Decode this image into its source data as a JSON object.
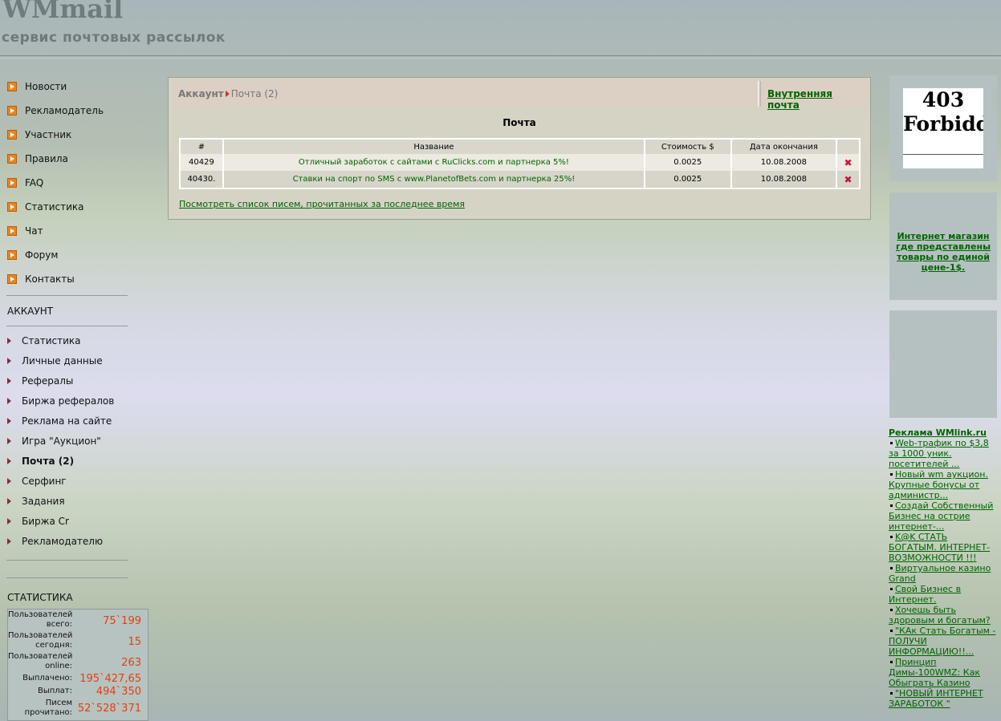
{
  "header": {
    "logo": "WMmail",
    "tagline": "сервис почтовых рассылок"
  },
  "nav": {
    "items": [
      "Новости",
      "Рекламодатель",
      "Участник",
      "Правила",
      "FAQ",
      "Статистика",
      "Чат",
      "Форум",
      "Контакты"
    ]
  },
  "account": {
    "title": "АККАУНТ",
    "items": [
      "Статистика",
      "Личные данные",
      "Рефералы",
      "Биржа рефералов",
      "Реклама на сайте",
      "Игра \"Аукцион\"",
      "Почта (2)",
      "Серфинг",
      "Задания",
      "Биржа Cr",
      "Рекламодателю"
    ],
    "active_index": 6
  },
  "stats": {
    "title": "СТАТИСТИКА",
    "rows": [
      {
        "label": "Пользователей всего:",
        "value": "75`199"
      },
      {
        "label": "Пользователей сегодня:",
        "value": "15"
      },
      {
        "label": "Пользователей online:",
        "value": "263"
      },
      {
        "label": "Выплачено:",
        "value": "195`427,65"
      },
      {
        "label": "Выплат:",
        "value": "494`350"
      },
      {
        "label": "Писем прочитано:",
        "value": "52`528`371"
      }
    ]
  },
  "panel": {
    "crumb_root": "Аккаунт",
    "crumb_sub": "Почта (2)",
    "internal_mail_link": "Внутренняя почта",
    "title": "Почта",
    "columns": [
      "#",
      "Название",
      "Стоимость $",
      "Дата окончания",
      ""
    ],
    "rows": [
      {
        "id": "40429",
        "name": "Отличный заработок с сайтами с RuClicks.com и партнерка 5%!",
        "cost": "0.0025",
        "date": "10.08.2008"
      },
      {
        "id": "40430.",
        "name": "Ставки на спорт по SMS с www.PlanetofBets.com и партнерка 25%!",
        "cost": "0.0025",
        "date": "10.08.2008"
      }
    ],
    "recent_link": "Посмотреть список писем, прочитанных за последнее время"
  },
  "right": {
    "forbidden_text_1": "403",
    "forbidden_text_2": "Forbidd",
    "shop_link": "Интернет магазин где представлены товары по единой цене-1$.",
    "wmlink_title": "Реклама WMlink.ru",
    "wmlink_items": [
      "Web-трафик по $3,8 за 1000 уник. посетителей ...",
      "Новый wm аукцион. Крупные бонусы от администр...",
      "Создай Собственный Бизнес на острие интернет-...",
      "K@K СТАТЬ БОГАТЫМ. ИНТЕРНЕТ-ВОЗМОЖНОСТИ !!!",
      "Виртуальное казино Grand",
      "Свой Бизнес в Интернет.",
      "Хочешь быть здоровым и богатым?",
      "\"КАк Стать Богатым - ПОЛУЧИ ИНФОРМАЦИЮ!!...",
      "Принцип Димы-100WMZ: Как Обыграть Казино",
      "\"НОВЫЙ ИНТЕРНЕТ ЗАРАБОТОК \""
    ]
  }
}
